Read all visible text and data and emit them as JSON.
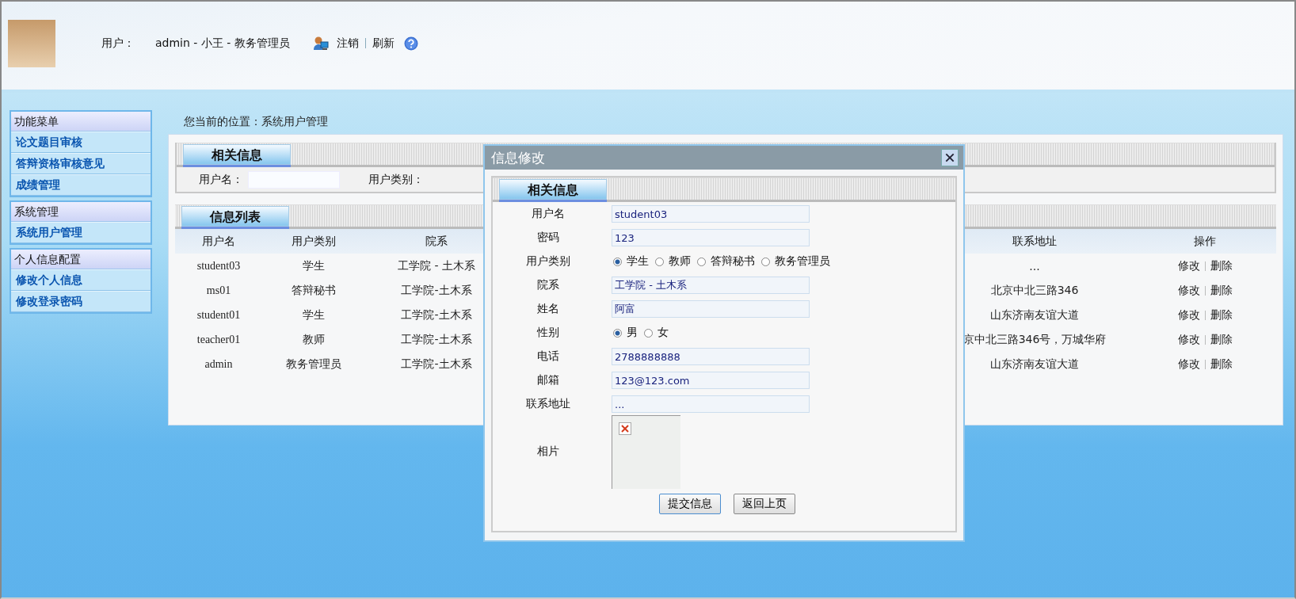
{
  "header": {
    "user_label": "用户：",
    "user_info": "admin - 小王 - 教务管理员",
    "links": [
      {
        "label": "注销"
      },
      {
        "label": "刷新"
      }
    ]
  },
  "menu": [
    {
      "title": "功能菜单",
      "items": [
        "论文题目审核",
        "答辩资格审核意见",
        "成绩管理"
      ]
    },
    {
      "title": "系统管理",
      "items": [
        "系统用户管理"
      ]
    },
    {
      "title": "个人信息配置",
      "items": [
        "修改个人信息",
        "修改登录密码"
      ]
    }
  ],
  "breadcrumb": "您当前的位置：系统用户管理",
  "search_panel": {
    "title": "相关信息",
    "fields": [
      "用户名：",
      "用户类别："
    ]
  },
  "list_panel": {
    "title": "信息列表",
    "columns": [
      "用户名",
      "用户类别",
      "院系",
      "联系地址",
      "操作"
    ],
    "rows": [
      {
        "cells": [
          "student03",
          "学生",
          "工学院 - 土木系",
          "..."
        ],
        "actions": [
          "修改",
          "删除"
        ]
      },
      {
        "cells": [
          "ms01",
          "答辩秘书",
          "工学院-土木系",
          "北京中北三路346"
        ],
        "actions": [
          "修改",
          "删除"
        ]
      },
      {
        "cells": [
          "student01",
          "学生",
          "工学院-土木系",
          "山东济南友谊大道"
        ],
        "actions": [
          "修改",
          "删除"
        ]
      },
      {
        "cells": [
          "teacher01",
          "教师",
          "工学院-土木系",
          "京中北三路346号，万城华府"
        ],
        "actions": [
          "修改",
          "删除"
        ]
      },
      {
        "cells": [
          "admin",
          "教务管理员",
          "工学院-土木系",
          "山东济南友谊大道"
        ],
        "actions": [
          "修改",
          "删除"
        ]
      }
    ]
  },
  "dialog": {
    "title": "信息修改",
    "section_title": "相关信息",
    "fields": [
      {
        "kind": "text",
        "label": "用户名",
        "value": "student03"
      },
      {
        "kind": "text",
        "label": "密码",
        "value": "123"
      },
      {
        "kind": "radio",
        "label": "用户类别",
        "options": [
          {
            "label": "学生",
            "selected": true
          },
          {
            "label": "教师",
            "selected": false
          },
          {
            "label": "答辩秘书",
            "selected": false
          },
          {
            "label": "教务管理员",
            "selected": false
          }
        ]
      },
      {
        "kind": "text",
        "label": "院系",
        "value": "工学院 - 土木系"
      },
      {
        "kind": "text",
        "label": "姓名",
        "value": "阿富"
      },
      {
        "kind": "radio",
        "label": "性别",
        "options": [
          {
            "label": "男",
            "selected": true
          },
          {
            "label": "女",
            "selected": false
          }
        ]
      },
      {
        "kind": "text",
        "label": "电话",
        "value": "2788888888"
      },
      {
        "kind": "text",
        "label": "邮箱",
        "value": "123@123.com"
      },
      {
        "kind": "text",
        "label": "联系地址",
        "value": "..."
      },
      {
        "kind": "photo",
        "label": "相片"
      }
    ],
    "buttons": [
      "提交信息",
      "返回上页"
    ]
  }
}
